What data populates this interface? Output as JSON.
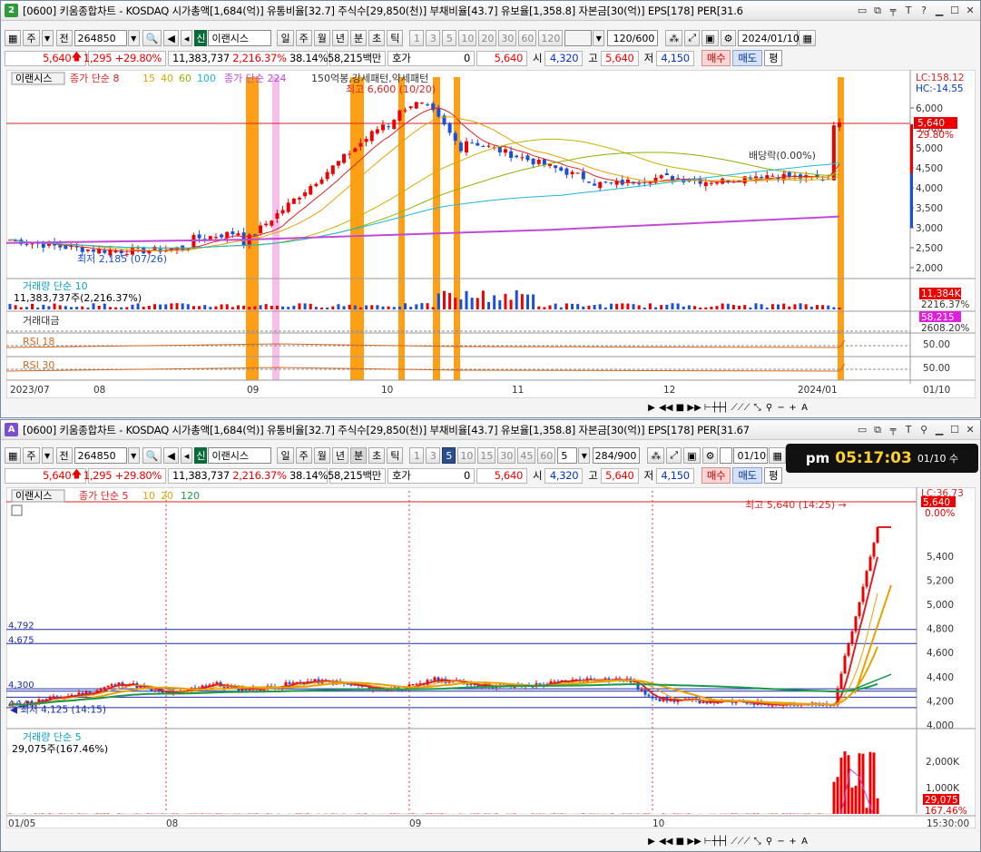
{
  "top": {
    "window_num": "2",
    "title": "[0600] 키움종합차트 - KOSDAQ 시가총액[1,684(억)] 유통비율[32.7] 주식수[29,850(천)] 부채비율[43.7] 유보율[1,358.8] 자본금[30(억)] EPS[178] PER[31.6",
    "toolbar": {
      "ju": "주",
      "jeon": "전",
      "code": "264850",
      "sin": "신",
      "name": "이랜시스",
      "periods": [
        "일",
        "주",
        "월",
        "년",
        "분",
        "초",
        "틱"
      ],
      "nums": [
        "1",
        "3",
        "5",
        "10",
        "20",
        "30",
        "60",
        "120"
      ],
      "count": "120/600",
      "date": "2024/01/10"
    },
    "quote": {
      "price": "5,640",
      "change": "1,295",
      "pct": "+29.80%",
      "volume": "11,383,737",
      "vol_ratio": "2,216.37%",
      "turnover": "38.14%",
      "amount": "58,215백만",
      "hoga_label": "호가",
      "hoga": "0",
      "cur": "5,640",
      "open_label": "시",
      "open": "4,320",
      "high_label": "고",
      "high": "5,640",
      "low_label": "저",
      "low": "4,150",
      "buy": "매수",
      "sell": "매도",
      "avg": "평"
    },
    "legend": {
      "name": "이랜시스",
      "ma_label": "종가 단순",
      "ma": [
        "8",
        "15",
        "40",
        "60",
        "100"
      ],
      "ma2_label": "종가 단순",
      "ma2": "224",
      "events": "150억봉,강세패턴,약세패턴"
    },
    "price_axis": [
      "6,000",
      "5,500",
      "5,000",
      "4,500",
      "4,000",
      "3,500",
      "3,000",
      "2,500",
      "2,000"
    ],
    "lc_hc": [
      "LC:158.12",
      "HC:-14.55"
    ],
    "cur_tag": [
      "5,640",
      "29.80%"
    ],
    "max_annot": "최고 6,600 (10/20)",
    "min_annot": "최저 2,185 (07/26)",
    "div_annot": "배당락(0.00%)",
    "vol_panel": {
      "title": "거래량 단순 10",
      "value": "11,383,737주(2,216.37%)",
      "tag1": "11,384K",
      "tag2": "2216.37%"
    },
    "amt_panel": {
      "title": "거래대금",
      "tag1": "58,215",
      "tag2": "2608.20%"
    },
    "rsi1": {
      "title": "RSI 18",
      "level": "50.00"
    },
    "rsi2": {
      "title": "RSI 30",
      "level": "50.00"
    },
    "x_labels": [
      "2023/07",
      "08",
      "09",
      "10",
      "11",
      "12",
      "2024/01",
      "01/10"
    ]
  },
  "bottom": {
    "window_num": "A",
    "title": "[0600] 키움종합차트 - KOSDAQ 시가총액[1,684(억)] 유통비율[32.7] 주식수[29,850(천)] 부채비율[43.7] 유보율[1,358.8] 자본금[30(억)] EPS[178] PER[31.67",
    "toolbar": {
      "ju": "주",
      "jeon": "전",
      "code": "264850",
      "sin": "신",
      "name": "이랜시스",
      "periods": [
        "일",
        "주",
        "월",
        "년",
        "분",
        "초",
        "틱"
      ],
      "nums": [
        "1",
        "3",
        "5",
        "10",
        "15",
        "30",
        "45",
        "60"
      ],
      "sel_num": "5",
      "interval": "5",
      "count": "284/900",
      "date": "01/10"
    },
    "legend": {
      "name": "이랜시스",
      "ma_label": "종가 단순",
      "ma": [
        "5",
        "10",
        "20",
        "120"
      ]
    },
    "price_axis": [
      "5,400",
      "5,200",
      "5,000",
      "4,800",
      "4,600",
      "4,400",
      "4,200",
      "4,000"
    ],
    "cur_tag": [
      "5,640",
      "0.00%"
    ],
    "lc": "LC:36.73",
    "max_annot": "최고 5,640 (14:25)",
    "min_annot": "최저 4,125 (14:15)",
    "lines": [
      "4,792",
      "4,675",
      "4,300",
      "4,144"
    ],
    "vol_panel": {
      "title": "거래량 단순 5",
      "value": "29,075주(167.46%)",
      "axis": [
        "2,000K",
        "1,000K"
      ],
      "tag1": "29,075",
      "tag2": "167.46%"
    },
    "x_labels": [
      "01/05",
      "08",
      "09",
      "10",
      "15:30:00"
    ]
  },
  "clock": {
    "ampm": "pm",
    "time": "05:17:03",
    "date": "01/10 수"
  }
}
